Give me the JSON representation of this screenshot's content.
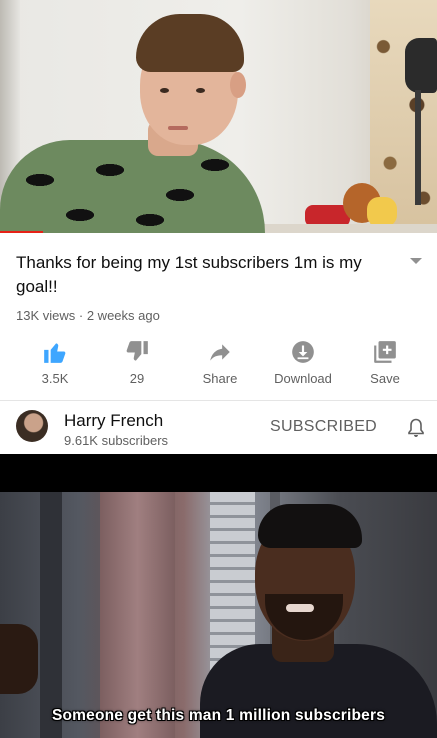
{
  "video": {
    "title": "Thanks for being my 1st subscribers 1m is my goal!!",
    "views": "13K views",
    "age": "2 weeks ago",
    "separator": "·",
    "expand_icon": "chevron-down-icon"
  },
  "actions": [
    {
      "icon": "thumbs-up-icon",
      "label": "3.5K",
      "color": "#3ea6ff"
    },
    {
      "icon": "thumbs-down-icon",
      "label": "29",
      "color": "#909090"
    },
    {
      "icon": "share-icon",
      "label": "Share",
      "color": "#909090"
    },
    {
      "icon": "download-icon",
      "label": "Download",
      "color": "#909090"
    },
    {
      "icon": "save-to-playlist-icon",
      "label": "Save",
      "color": "#909090"
    }
  ],
  "channel": {
    "name": "Harry French",
    "subscribers": "9.61K subscribers",
    "subscribe_state": "SUBSCRIBED",
    "bell_icon": "bell-icon"
  },
  "meme": {
    "caption": "Someone get this man 1 million subscribers"
  },
  "colors": {
    "progress": "#e62117",
    "like_active": "#3ea6ff",
    "secondary_text": "#606060"
  }
}
